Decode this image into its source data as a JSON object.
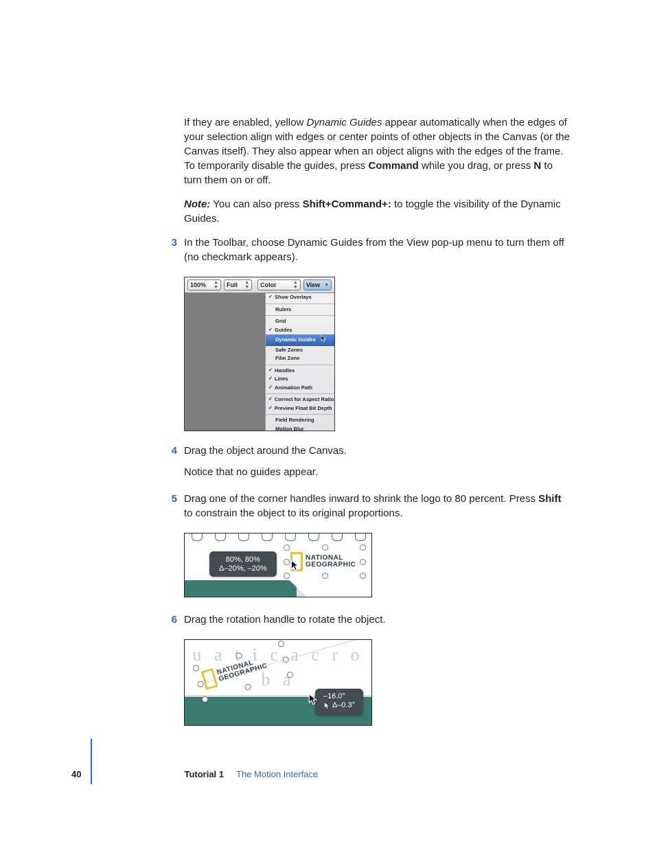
{
  "para1": {
    "pre": "If they are enabled, yellow ",
    "em": "Dynamic Guides",
    "post": " appear automatically when the edges of your selection align with edges or center points of other objects in the Canvas (or the Canvas itself). They also appear when an object aligns with the edges of the frame. To temporarily disable the guides, press ",
    "b1": "Command",
    "mid": " while you drag, or press ",
    "b2": "N",
    "tail": " to turn them on or off."
  },
  "note": {
    "label": "Note:",
    "pre": "  You can also press ",
    "b": "Shift+Command+:",
    "post": " to toggle the visibility of the Dynamic Guides."
  },
  "steps": {
    "s3": {
      "num": "3",
      "text": "In the Toolbar, choose Dynamic Guides from the View pop-up menu to turn them off (no checkmark appears)."
    },
    "s4": {
      "num": "4",
      "line1": "Drag the object around the Canvas.",
      "line2": "Notice that no guides appear."
    },
    "s5": {
      "num": "5",
      "pre": "Drag one of the corner handles inward to shrink the logo to 80 percent. Press ",
      "b": "Shift",
      "post": " to constrain the object to its original proportions."
    },
    "s6": {
      "num": "6",
      "text": "Drag the rotation handle to rotate the object."
    }
  },
  "fig1": {
    "toolbar": {
      "zoom": "100%",
      "full": "Full",
      "color": "Color",
      "view": "View"
    },
    "menu": {
      "show_overlays": "Show Overlays",
      "rulers": "Rulers",
      "grid": "Grid",
      "guides": "Guides",
      "dynamic_guides": "Dynamic Guides",
      "safe_zones": "Safe Zones",
      "film_zone": "Film Zone",
      "handles": "Handles",
      "lines": "Lines",
      "animation_path": "Animation Path",
      "correct_aspect": "Correct for Aspect Ratio",
      "preview_float": "Preview Float Bit Depth",
      "field_rendering": "Field Rendering",
      "motion_blur": "Motion Blur"
    }
  },
  "fig2": {
    "pill_l1": "80%, 80%",
    "pill_l2": "Δ–20%, –20%",
    "ng_l1": "NATIONAL",
    "ng_l2": "GEOGRAPHIC"
  },
  "fig3": {
    "bg": "u a t i c   a c r o b a",
    "ng_l1": "NATIONAL",
    "ng_l2": "GEOGRAPHIC",
    "pill_l1": "–16.0°",
    "pill_l2": "Δ–0.3°"
  },
  "footer": {
    "page": "40",
    "tutorial_label": "Tutorial 1",
    "tutorial_title": "The Motion Interface"
  }
}
